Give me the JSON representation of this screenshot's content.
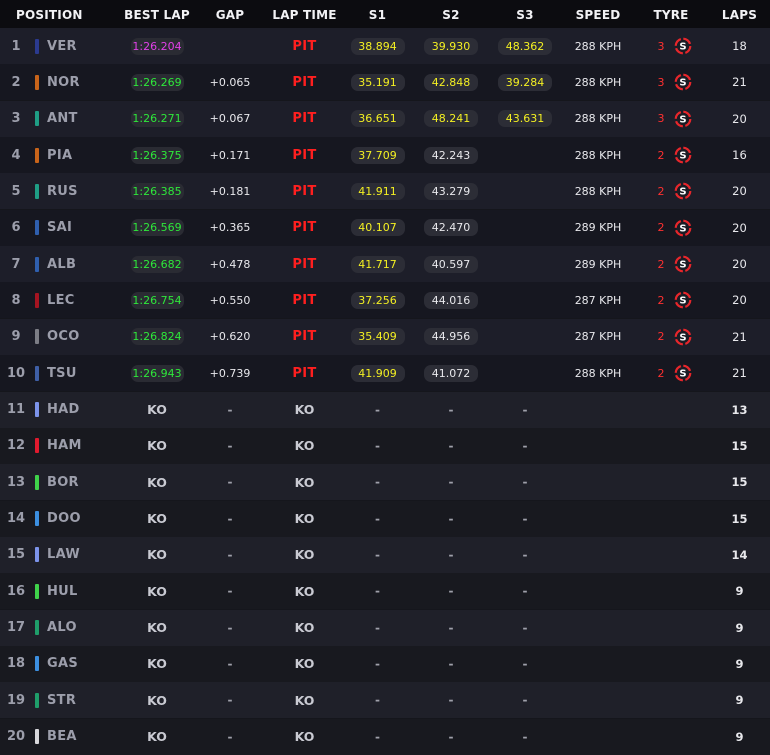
{
  "headers": {
    "position": "POSITION",
    "best_lap": "BEST LAP",
    "gap": "GAP",
    "lap_time": "LAP TIME",
    "s1": "S1",
    "s2": "S2",
    "s3": "S3",
    "speed": "SPEED",
    "tyre": "TYRE",
    "laps": "LAPS"
  },
  "colors": {
    "purple": "#e040e8",
    "green": "#2ee83a",
    "yellow": "#f4f022",
    "pit_red": "#ff1f1f",
    "soft_tyre": "#e8262b"
  },
  "drivers": [
    {
      "pos": "1",
      "code": "VER",
      "team_color": "#2b3a8f",
      "best": "1:26.204",
      "best_style": "purple",
      "gap": "",
      "lap": "PIT",
      "s1": "38.894",
      "s2": "39.930",
      "s3": "48.362",
      "speed": "288 KPH",
      "tyre_age": "3",
      "tyre": "S",
      "tyre_icon": "soft-tyre",
      "laps": "18"
    },
    {
      "pos": "2",
      "code": "NOR",
      "team_color": "#c8641a",
      "best": "1:26.269",
      "best_style": "green",
      "gap": "+0.065",
      "lap": "PIT",
      "s1": "35.191",
      "s2": "42.848",
      "s3": "39.284",
      "speed": "288 KPH",
      "tyre_age": "3",
      "tyre": "S",
      "tyre_icon": "soft-tyre",
      "laps": "21"
    },
    {
      "pos": "3",
      "code": "ANT",
      "team_color": "#1f9e85",
      "best": "1:26.271",
      "best_style": "green",
      "gap": "+0.067",
      "lap": "PIT",
      "s1": "36.651",
      "s2": "48.241",
      "s3": "43.631",
      "speed": "288 KPH",
      "tyre_age": "3",
      "tyre": "S",
      "tyre_icon": "soft-tyre",
      "laps": "20"
    },
    {
      "pos": "4",
      "code": "PIA",
      "team_color": "#c8641a",
      "best": "1:26.375",
      "best_style": "green",
      "gap": "+0.171",
      "lap": "PIT",
      "s1": "37.709",
      "s2": "42.243",
      "s3": "",
      "speed": "288 KPH",
      "tyre_age": "2",
      "tyre": "S",
      "tyre_icon": "soft-tyre",
      "laps": "16"
    },
    {
      "pos": "5",
      "code": "RUS",
      "team_color": "#1f9e85",
      "best": "1:26.385",
      "best_style": "green",
      "gap": "+0.181",
      "lap": "PIT",
      "s1": "41.911",
      "s2": "43.279",
      "s3": "",
      "speed": "288 KPH",
      "tyre_age": "2",
      "tyre": "S",
      "tyre_icon": "soft-tyre",
      "laps": "20"
    },
    {
      "pos": "6",
      "code": "SAI",
      "team_color": "#2f5fae",
      "best": "1:26.569",
      "best_style": "green",
      "gap": "+0.365",
      "lap": "PIT",
      "s1": "40.107",
      "s2": "42.470",
      "s3": "",
      "speed": "289 KPH",
      "tyre_age": "2",
      "tyre": "S",
      "tyre_icon": "soft-tyre",
      "laps": "20"
    },
    {
      "pos": "7",
      "code": "ALB",
      "team_color": "#2f5fae",
      "best": "1:26.682",
      "best_style": "green",
      "gap": "+0.478",
      "lap": "PIT",
      "s1": "41.717",
      "s2": "40.597",
      "s3": "",
      "speed": "289 KPH",
      "tyre_age": "2",
      "tyre": "S",
      "tyre_icon": "soft-tyre",
      "laps": "20"
    },
    {
      "pos": "8",
      "code": "LEC",
      "team_color": "#a51421",
      "best": "1:26.754",
      "best_style": "green",
      "gap": "+0.550",
      "lap": "PIT",
      "s1": "37.256",
      "s2": "44.016",
      "s3": "",
      "speed": "287 KPH",
      "tyre_age": "2",
      "tyre": "S",
      "tyre_icon": "soft-tyre",
      "laps": "20"
    },
    {
      "pos": "9",
      "code": "OCO",
      "team_color": "#7c7d85",
      "best": "1:26.824",
      "best_style": "green",
      "gap": "+0.620",
      "lap": "PIT",
      "s1": "35.409",
      "s2": "44.956",
      "s3": "",
      "speed": "287 KPH",
      "tyre_age": "2",
      "tyre": "S",
      "tyre_icon": "soft-tyre",
      "laps": "21"
    },
    {
      "pos": "10",
      "code": "TSU",
      "team_color": "#3f5fa6",
      "best": "1:26.943",
      "best_style": "green",
      "gap": "+0.739",
      "lap": "PIT",
      "s1": "41.909",
      "s2": "41.072",
      "s3": "",
      "speed": "288 KPH",
      "tyre_age": "2",
      "tyre": "S",
      "tyre_icon": "soft-tyre",
      "laps": "21"
    },
    {
      "pos": "11",
      "code": "HAD",
      "team_color": "#7c93ea",
      "best": "KO",
      "gap": "-",
      "lap": "KO",
      "s1": "-",
      "s2": "-",
      "s3": "-",
      "speed": "",
      "tyre_age": "",
      "tyre": "",
      "laps": "13"
    },
    {
      "pos": "12",
      "code": "HAM",
      "team_color": "#e01a2e",
      "best": "KO",
      "gap": "-",
      "lap": "KO",
      "s1": "-",
      "s2": "-",
      "s3": "-",
      "speed": "",
      "tyre_age": "",
      "tyre": "",
      "laps": "15"
    },
    {
      "pos": "13",
      "code": "BOR",
      "team_color": "#3fd24a",
      "best": "KO",
      "gap": "-",
      "lap": "KO",
      "s1": "-",
      "s2": "-",
      "s3": "-",
      "speed": "",
      "tyre_age": "",
      "tyre": "",
      "laps": "15"
    },
    {
      "pos": "14",
      "code": "DOO",
      "team_color": "#3c8fe0",
      "best": "KO",
      "gap": "-",
      "lap": "KO",
      "s1": "-",
      "s2": "-",
      "s3": "-",
      "speed": "",
      "tyre_age": "",
      "tyre": "",
      "laps": "15"
    },
    {
      "pos": "15",
      "code": "LAW",
      "team_color": "#7c93ea",
      "best": "KO",
      "gap": "-",
      "lap": "KO",
      "s1": "-",
      "s2": "-",
      "s3": "-",
      "speed": "",
      "tyre_age": "",
      "tyre": "",
      "laps": "14"
    },
    {
      "pos": "16",
      "code": "HUL",
      "team_color": "#3fd24a",
      "best": "KO",
      "gap": "-",
      "lap": "KO",
      "s1": "-",
      "s2": "-",
      "s3": "-",
      "speed": "",
      "tyre_age": "",
      "tyre": "",
      "laps": "9"
    },
    {
      "pos": "17",
      "code": "ALO",
      "team_color": "#1f9e6a",
      "best": "KO",
      "gap": "-",
      "lap": "KO",
      "s1": "-",
      "s2": "-",
      "s3": "-",
      "speed": "",
      "tyre_age": "",
      "tyre": "",
      "laps": "9"
    },
    {
      "pos": "18",
      "code": "GAS",
      "team_color": "#3c8fe0",
      "best": "KO",
      "gap": "-",
      "lap": "KO",
      "s1": "-",
      "s2": "-",
      "s3": "-",
      "speed": "",
      "tyre_age": "",
      "tyre": "",
      "laps": "9"
    },
    {
      "pos": "19",
      "code": "STR",
      "team_color": "#1f9e6a",
      "best": "KO",
      "gap": "-",
      "lap": "KO",
      "s1": "-",
      "s2": "-",
      "s3": "-",
      "speed": "",
      "tyre_age": "",
      "tyre": "",
      "laps": "9"
    },
    {
      "pos": "20",
      "code": "BEA",
      "team_color": "#d8d8dc",
      "best": "KO",
      "gap": "-",
      "lap": "KO",
      "s1": "-",
      "s2": "-",
      "s3": "-",
      "speed": "",
      "tyre_age": "",
      "tyre": "",
      "laps": "9"
    }
  ]
}
